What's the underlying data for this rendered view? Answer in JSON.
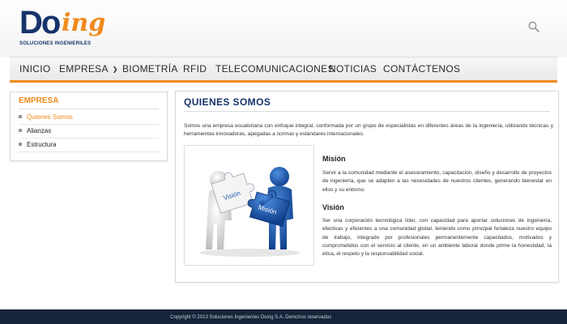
{
  "brand": {
    "logo_main": "Do",
    "logo_script": "ing",
    "logo_tagline": "SOLUCIONES INGENIERILES"
  },
  "nav": {
    "items": [
      {
        "label": "INICIO"
      },
      {
        "label": "EMPRESA"
      },
      {
        "label": "BIOMETRÍA"
      },
      {
        "label": "RFID"
      },
      {
        "label": "TELECOMUNICACIONES"
      },
      {
        "label": "NOTICIAS"
      },
      {
        "label": "CONTÁCTENOS"
      }
    ]
  },
  "sidebar": {
    "title": "EMPRESA",
    "items": [
      {
        "label": "Quienes Somos",
        "active": true
      },
      {
        "label": "Alianzas",
        "active": false
      },
      {
        "label": "Estructura",
        "active": false
      }
    ]
  },
  "main": {
    "title": "QUIENES SOMOS",
    "intro": "Somos una empresa ecuatoriana con enfoque integral, conformada por un grupo de especialistas en diferentes áreas de la ingeniería, utilizando técnicas y herramientas innovadoras, apegadas a normas y estándares internacionales.",
    "image": {
      "puzzle_left_label": "Visión",
      "puzzle_right_label": "Misión"
    },
    "mision_title": "Misión",
    "mision_text": "Servir a la comunidad mediante el asesoramiento, capacitación, diseño y desarrollo de proyectos de ingeniería, que se adapten a las necesidades de nuestros clientes, generando bienestar en ellos y su entorno.",
    "vision_title": "Visión",
    "vision_text": "Ser una corporación tecnológica líder, con capacidad para aportar soluciones de ingeniería, efectivas y eficientes a una comunidad global, teniendo como principal fortaleza nuestro equipo de trabajo, integrado por profesionales permanentemente capacitados, motivados y comprometidos con el servicio al cliente, en un ambiente laboral donde prime la honestidad, la ética, el respeto y la responsabilidad social."
  },
  "footer": {
    "text": "Copyright © 2013 Soluciones Ingenieriles Doing S.A. Derechos reservados"
  },
  "colors": {
    "accent": "#f08a1c",
    "brand": "#16336a",
    "footer_bg": "#16243a"
  },
  "icons": {
    "search": "search-icon",
    "chevron": "chevron-down-icon"
  }
}
